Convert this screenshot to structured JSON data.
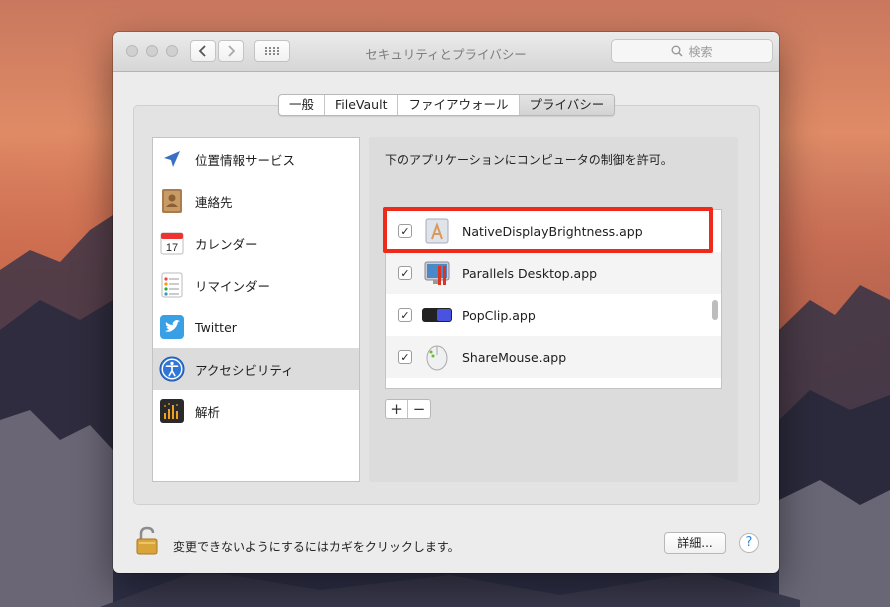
{
  "window": {
    "title": "セキュリティとプライバシー",
    "search_placeholder": "検索"
  },
  "tabs": [
    {
      "label": "一般",
      "active": false
    },
    {
      "label": "FileVault",
      "active": false
    },
    {
      "label": "ファイアウォール",
      "active": false
    },
    {
      "label": "プライバシー",
      "active": true
    }
  ],
  "sidebar": {
    "items": [
      {
        "label": "位置情報サービス",
        "icon": "location-arrow-icon"
      },
      {
        "label": "連絡先",
        "icon": "contacts-icon"
      },
      {
        "label": "カレンダー",
        "icon": "calendar-icon",
        "icon_text": "17"
      },
      {
        "label": "リマインダー",
        "icon": "reminders-icon"
      },
      {
        "label": "Twitter",
        "icon": "twitter-icon"
      },
      {
        "label": "アクセシビリティ",
        "icon": "accessibility-icon",
        "selected": true
      },
      {
        "label": "解析",
        "icon": "analytics-icon"
      }
    ]
  },
  "main": {
    "prompt": "下のアプリケーションにコンピュータの制御を許可。",
    "apps": [
      {
        "name": "NativeDisplayBrightness.app",
        "checked": true,
        "icon": "app-store-icon",
        "highlighted": true
      },
      {
        "name": "Parallels Desktop.app",
        "checked": true,
        "icon": "parallels-icon"
      },
      {
        "name": "PopClip.app",
        "checked": true,
        "icon": "popclip-icon"
      },
      {
        "name": "ShareMouse.app",
        "checked": true,
        "icon": "mouse-icon"
      }
    ],
    "add_label": "+",
    "remove_label": "−",
    "checkmark": "✓"
  },
  "footer": {
    "lock_text": "変更できないようにするにはカギをクリックします。",
    "advanced_label": "詳細...",
    "help_label": "?"
  },
  "colors": {
    "highlight": "#ee2a1a",
    "accent": "#2c86e6"
  }
}
